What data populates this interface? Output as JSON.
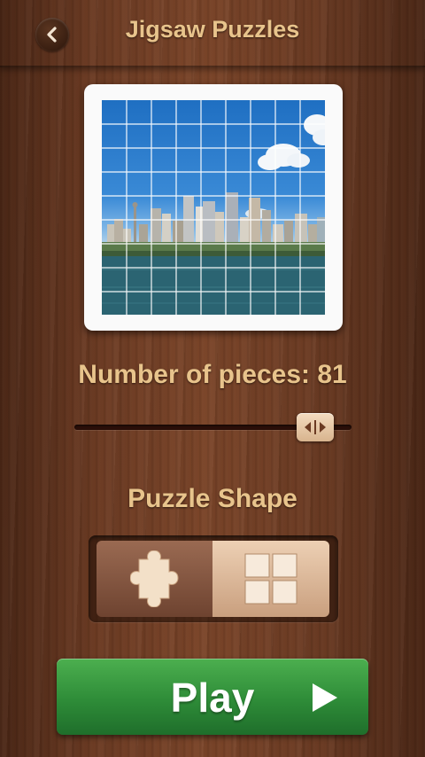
{
  "header": {
    "title": "Jigsaw Puzzles",
    "back_icon": "chevron-left-icon"
  },
  "preview": {
    "description_icon": "city-skyline-image",
    "grid_columns": 9,
    "grid_rows": 9
  },
  "pieces": {
    "label": "Number of pieces: 81",
    "value": 81,
    "slider_fraction": 0.87,
    "handle_icon": "slider-arrows-icon"
  },
  "shape": {
    "label": "Puzzle Shape",
    "options": [
      {
        "name": "jigsaw",
        "icon": "jigsaw-piece-icon",
        "selected": true
      },
      {
        "name": "square",
        "icon": "square-grid-icon",
        "selected": false
      }
    ]
  },
  "play": {
    "label": "Play",
    "icon": "play-arrow-icon"
  },
  "colors": {
    "label_text": "#e8c48c",
    "play_green": "#2e8c38",
    "wood_dark": "#4a2615"
  }
}
